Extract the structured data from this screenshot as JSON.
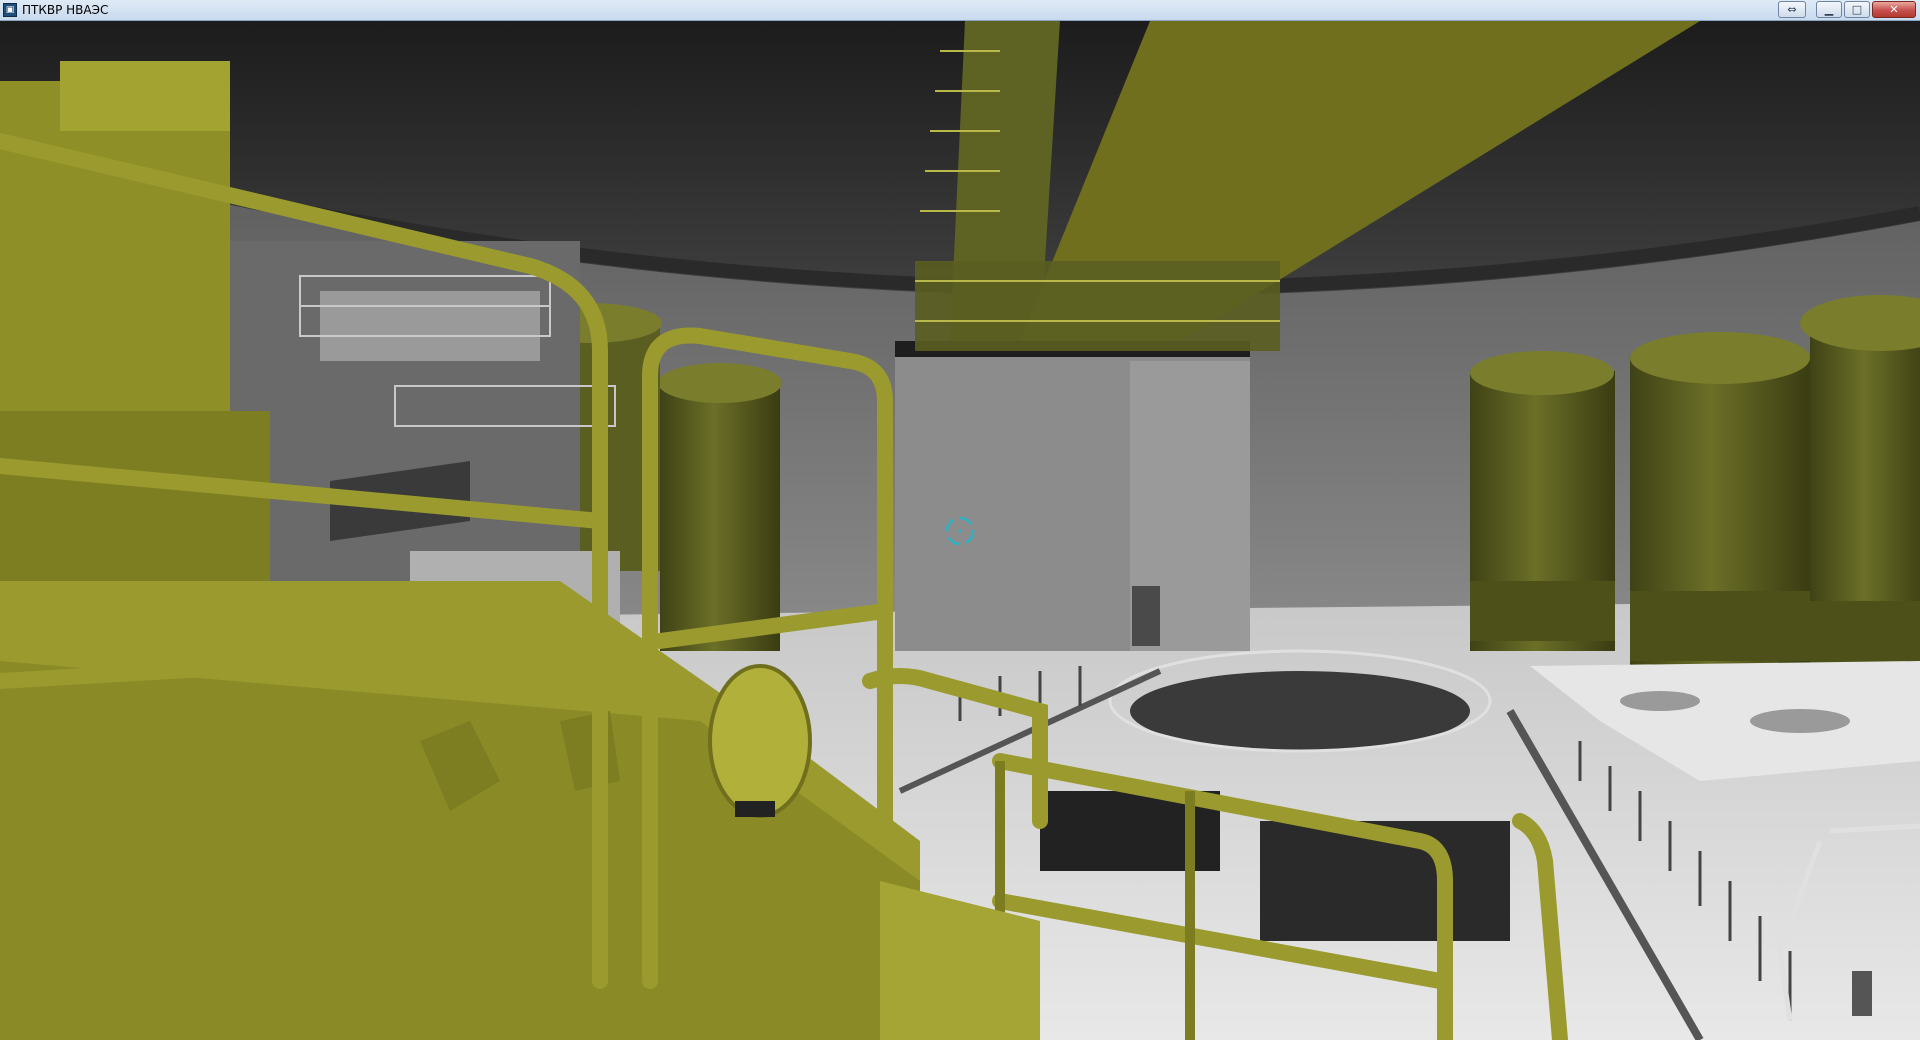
{
  "window": {
    "title": "ПТКВР НВАЭС",
    "app_icon_glyph": "▣",
    "buttons": {
      "swap_glyph": "⇔",
      "minimize_glyph": "▁",
      "maximize_glyph": "□",
      "close_glyph": "✕"
    }
  },
  "scene": {
    "crosshair_color": "#2fb3c4",
    "equipment_color": "#9a9a2e",
    "equipment_dark": "#6f6f1e",
    "tank_color": "#5e6222",
    "wall_color": "#7a7a7a",
    "floor_color": "#d4d4d4",
    "ceiling_color": "#3a3a3a"
  }
}
